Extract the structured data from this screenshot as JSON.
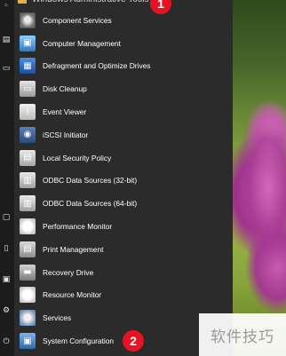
{
  "menu": {
    "header_label": "Windows Administrative Tools",
    "items": [
      {
        "label": "Component Services",
        "icon": "component-services-icon",
        "glyph": "⚙"
      },
      {
        "label": "Computer Management",
        "icon": "computer-management-icon",
        "glyph": "▣"
      },
      {
        "label": "Defragment and Optimize Drives",
        "icon": "defrag-icon",
        "glyph": "▦"
      },
      {
        "label": "Disk Cleanup",
        "icon": "disk-cleanup-icon",
        "glyph": "▭"
      },
      {
        "label": "Event Viewer",
        "icon": "event-viewer-icon",
        "glyph": "!"
      },
      {
        "label": "iSCSI Initiator",
        "icon": "iscsi-icon",
        "glyph": "◉"
      },
      {
        "label": "Local Security Policy",
        "icon": "security-policy-icon",
        "glyph": "▤"
      },
      {
        "label": "ODBC Data Sources (32-bit)",
        "icon": "odbc-icon",
        "glyph": "▥"
      },
      {
        "label": "ODBC Data Sources (64-bit)",
        "icon": "odbc-icon",
        "glyph": "▥"
      },
      {
        "label": "Performance Monitor",
        "icon": "performance-monitor-icon",
        "glyph": "◔"
      },
      {
        "label": "Print Management",
        "icon": "print-management-icon",
        "glyph": "▤"
      },
      {
        "label": "Recovery Drive",
        "icon": "recovery-drive-icon",
        "glyph": "▬"
      },
      {
        "label": "Resource Monitor",
        "icon": "resource-monitor-icon",
        "glyph": "◔"
      },
      {
        "label": "Services",
        "icon": "services-icon",
        "glyph": "⚙"
      },
      {
        "label": "System Configuration",
        "icon": "system-configuration-icon",
        "glyph": "▣"
      }
    ]
  },
  "badges": {
    "first": "1",
    "second": "2"
  },
  "watermark": "软件技巧",
  "colors": {
    "menu_bg": "#2b2b2b",
    "badge": "#e81224",
    "rail_bg": "#1c1c1c"
  }
}
